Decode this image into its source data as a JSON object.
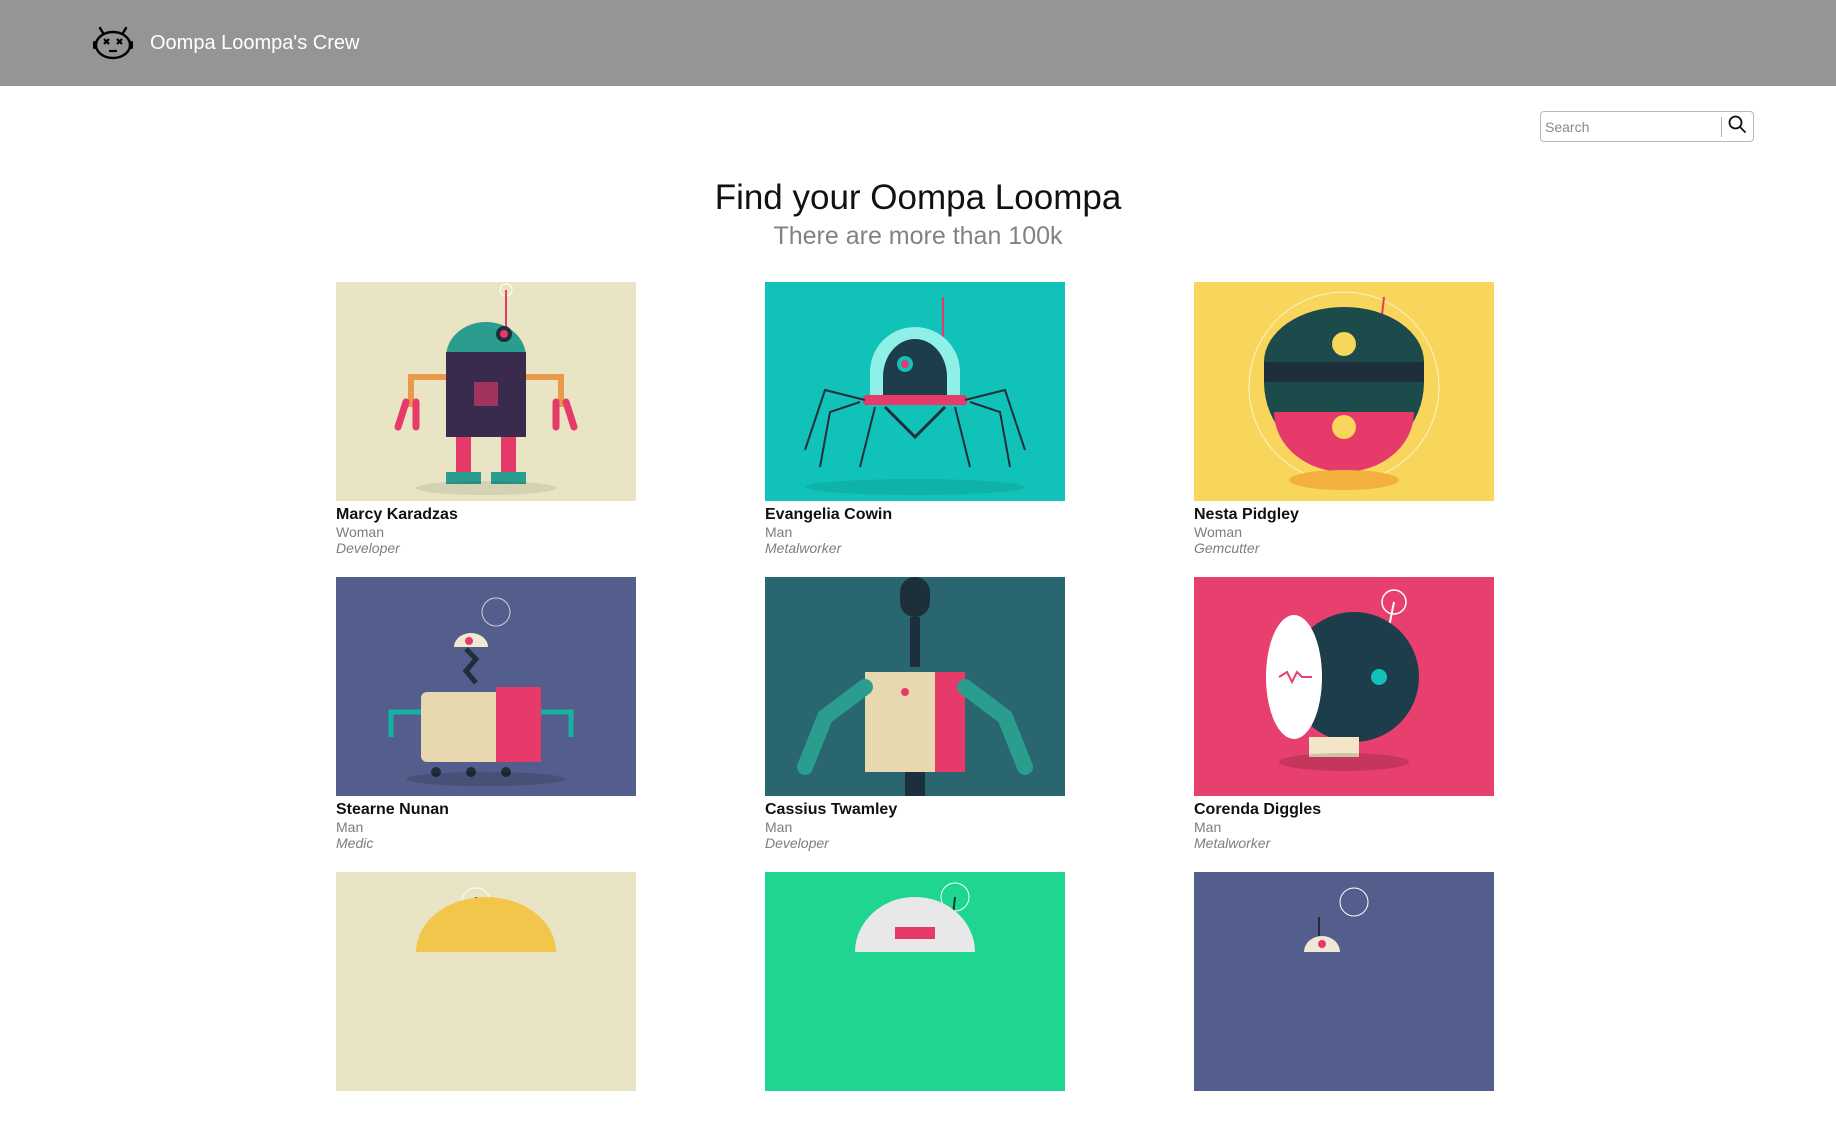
{
  "header": {
    "brand_name": "Oompa Loompa's Crew",
    "logo_icon": "robot-head-icon",
    "background": "#959595"
  },
  "search": {
    "placeholder": "Search",
    "icon": "search-icon"
  },
  "hero": {
    "title": "Find your Oompa Loompa",
    "subtitle": "There are more than 100k"
  },
  "cards": [
    {
      "name": "Marcy Karadzas",
      "gender": "Woman",
      "profession": "Developer",
      "bg": "#e8e4c4",
      "body": "#2a9d8f",
      "accent": "#e63a6a"
    },
    {
      "name": "Evangelia Cowin",
      "gender": "Man",
      "profession": "Metalworker",
      "bg": "#11c2b8",
      "body": "#1d3d4a",
      "accent": "#e63a6a"
    },
    {
      "name": "Nesta Pidgley",
      "gender": "Woman",
      "profession": "Gemcutter",
      "bg": "#f8d65c",
      "body": "#1d4a4a",
      "accent": "#e63a6a"
    },
    {
      "name": "Stearne Nunan",
      "gender": "Man",
      "profession": "Medic",
      "bg": "#545e8c",
      "body": "#e8d8b0",
      "accent": "#e63a6a"
    },
    {
      "name": "Cassius Twamley",
      "gender": "Man",
      "profession": "Developer",
      "bg": "#2a6670",
      "body": "#2a9d8f",
      "accent": "#e63a6a"
    },
    {
      "name": "Corenda Diggles",
      "gender": "Man",
      "profession": "Metalworker",
      "bg": "#e8406e",
      "body": "#1d3d4a",
      "accent": "#f3f3f3"
    },
    {
      "name": "",
      "gender": "",
      "profession": "",
      "bg": "#e8e4c4",
      "body": "#f1c64a",
      "accent": "#e63a6a"
    },
    {
      "name": "",
      "gender": "",
      "profession": "",
      "bg": "#1ed690",
      "body": "#e8e8e8",
      "accent": "#e63a6a"
    },
    {
      "name": "",
      "gender": "",
      "profession": "",
      "bg": "#545e8c",
      "body": "#e8d8b0",
      "accent": "#e63a6a"
    }
  ]
}
